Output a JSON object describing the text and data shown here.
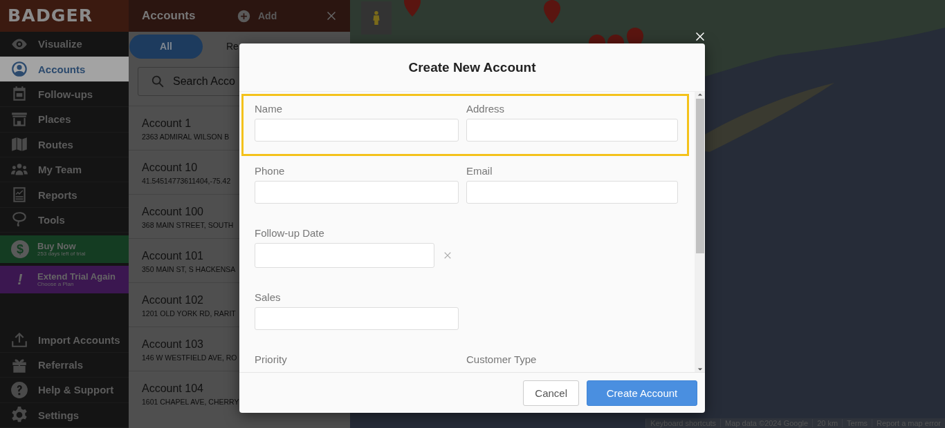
{
  "sidebar": {
    "logo": "BADGER",
    "items": [
      {
        "label": "Visualize",
        "selected": false
      },
      {
        "label": "Accounts",
        "selected": true
      },
      {
        "label": "Follow-ups",
        "selected": false
      },
      {
        "label": "Places",
        "selected": false
      },
      {
        "label": "Routes",
        "selected": false
      },
      {
        "label": "My Team",
        "selected": false
      },
      {
        "label": "Reports",
        "selected": false
      },
      {
        "label": "Tools",
        "selected": false
      }
    ],
    "promos": [
      {
        "kind": "buy",
        "glyph": "$",
        "title": "Buy Now",
        "subtitle": "253 days left of trial"
      },
      {
        "kind": "extend",
        "glyph": "!",
        "title": "Extend Trial Again",
        "subtitle": "Choose a Plan"
      }
    ],
    "bottom_items": [
      {
        "label": "Import Accounts"
      },
      {
        "label": "Referrals"
      },
      {
        "label": "Help & Support"
      },
      {
        "label": "Settings"
      }
    ]
  },
  "accounts_panel": {
    "title": "Accounts",
    "add_label": "Add",
    "tabs": [
      {
        "label": "All",
        "selected": true
      },
      {
        "label": "Re",
        "selected": false
      }
    ],
    "search": {
      "placeholder": "Search Acco"
    },
    "rows": [
      {
        "name": "Account 1",
        "address": "2363 ADMIRAL WILSON B"
      },
      {
        "name": "Account 10",
        "address": "41.54514773611404,-75.42"
      },
      {
        "name": "Account 100",
        "address": "368 MAIN STREET, SOUTH"
      },
      {
        "name": "Account 101",
        "address": "350 MAIN ST, S HACKENSA"
      },
      {
        "name": "Account 102",
        "address": "1201 OLD YORK RD, RARIT"
      },
      {
        "name": "Account 103",
        "address": "146 W WESTFIELD AVE, RO"
      },
      {
        "name": "Account 104",
        "address": "1601 CHAPEL AVE, CHERRY"
      }
    ]
  },
  "map": {
    "attribution": [
      "Keyboard shortcuts",
      "Map data ©2024 Google",
      "20 km",
      "Terms",
      "Report a map error"
    ]
  },
  "modal": {
    "title": "Create New Account",
    "rows": [
      {
        "highlighted": true,
        "fields": [
          {
            "label": "Name",
            "kind": "text"
          },
          {
            "label": "Address",
            "kind": "text"
          }
        ]
      },
      {
        "highlighted": false,
        "fields": [
          {
            "label": "Phone",
            "kind": "text"
          },
          {
            "label": "Email",
            "kind": "text"
          }
        ]
      },
      {
        "highlighted": false,
        "fields": [
          {
            "label": "Follow-up Date",
            "kind": "date"
          }
        ]
      },
      {
        "highlighted": false,
        "fields": [
          {
            "label": "Sales",
            "kind": "text"
          }
        ]
      },
      {
        "highlighted": false,
        "fields": [
          {
            "label": "Priority",
            "kind": "partial"
          },
          {
            "label": "Customer Type",
            "kind": "partial"
          }
        ]
      }
    ],
    "buttons": [
      {
        "label": "Cancel",
        "kind": "secondary"
      },
      {
        "label": "Create Account",
        "kind": "primary"
      }
    ]
  }
}
